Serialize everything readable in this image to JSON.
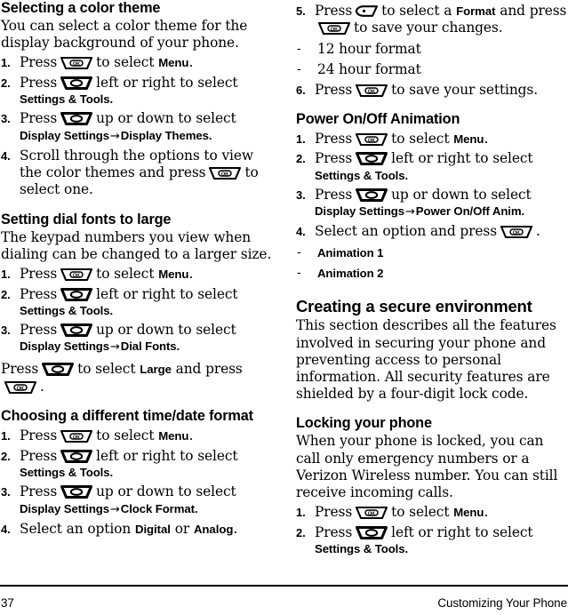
{
  "document": {
    "page_number": "37",
    "running_head": "Customizing Your Phone"
  },
  "icons": {
    "ok_key": "ok-key-icon",
    "ok_key_label": "OK",
    "direction_key": "direction-key-icon",
    "dot_key": "dot-key-icon",
    "arrow": "→",
    "dash": "-"
  },
  "left_column": {
    "sections": [
      {
        "id": "selecting-a-color-theme",
        "heading": "Selecting a color theme",
        "heading_level": "h2",
        "intro": "You can select a color theme for the display background of your phone.",
        "steps": [
          {
            "num": "1.",
            "pre": "Press",
            "key": "ok",
            "post": "to select ",
            "bold": "Menu",
            "tail": "."
          },
          {
            "num": "2.",
            "pre": "Press",
            "key": "dir",
            "post": "left or right to select",
            "path": [
              "Settings & Tools"
            ],
            "path_tail": "."
          },
          {
            "num": "3.",
            "pre": "Press",
            "key": "dir",
            "post": "up or down to select",
            "path": [
              "Display Settings",
              "Display Themes"
            ],
            "path_tail": "."
          },
          {
            "num": "4.",
            "pre": "Scroll through the options to view the color themes and press",
            "key": "ok",
            "post": "to select one."
          }
        ]
      },
      {
        "id": "setting-dial-fonts-to-large",
        "heading": "Setting dial fonts to large",
        "heading_level": "h2",
        "intro": "The keypad numbers you view when dialing can be changed to a larger size.",
        "steps": [
          {
            "num": "1.",
            "pre": "Press",
            "key": "ok",
            "post": "to select ",
            "bold": "Menu",
            "tail": "."
          },
          {
            "num": "2.",
            "pre": "Press",
            "key": "dir",
            "post": "left or right to select",
            "path": [
              "Settings & Tools"
            ],
            "path_tail": "."
          },
          {
            "num": "3.",
            "pre": "Press",
            "key": "dir",
            "post": "up or down to select",
            "path": [
              "Display Settings",
              "Dial Fonts"
            ],
            "path_tail": "."
          }
        ],
        "plain_step": {
          "pre": "Press",
          "key": "dir",
          "mid": "to select ",
          "bold": "Large",
          "mid2": " and press",
          "key2": "ok",
          "tail": "."
        }
      },
      {
        "id": "choosing-a-different-time-date-format",
        "heading": "Choosing a different time/date format",
        "heading_level": "h2",
        "steps": [
          {
            "num": "1.",
            "pre": "Press",
            "key": "ok",
            "post": "to select ",
            "bold": "Menu",
            "tail": "."
          },
          {
            "num": "2.",
            "pre": "Press",
            "key": "dir",
            "post": "left or right to select",
            "path": [
              "Settings & Tools"
            ],
            "path_tail": "."
          },
          {
            "num": "3.",
            "pre": "Press",
            "key": "dir",
            "post": "up or down to select",
            "path": [
              "Display Settings",
              "Clock Format"
            ],
            "path_tail": "."
          },
          {
            "num": "4.",
            "pre": "Select an option ",
            "bold": "Digital",
            "mid": " or ",
            "bold2": "Analog",
            "tail": "."
          }
        ]
      }
    ]
  },
  "right_column": {
    "sections": [
      {
        "id": "time-date-format-continued",
        "steps": [
          {
            "num": "5.",
            "pre": "Press",
            "key": "dot",
            "post": "to select a ",
            "bold": "Format",
            "mid": " and press",
            "key2": "ok",
            "tail": "to save your changes."
          }
        ],
        "dashes": [
          "12 hour format",
          "24 hour format"
        ],
        "dashes_bold": false,
        "steps_after": [
          {
            "num": "6.",
            "pre": "Press",
            "key": "ok",
            "post": "to save your settings."
          }
        ]
      },
      {
        "id": "power-on-off-animation",
        "heading": "Power On/Off Animation",
        "heading_level": "h2",
        "steps": [
          {
            "num": "1.",
            "pre": "Press",
            "key": "ok",
            "post": "to select ",
            "bold": "Menu",
            "tail": "."
          },
          {
            "num": "2.",
            "pre": "Press",
            "key": "dir",
            "post": "left or right to select",
            "path": [
              "Settings & Tools"
            ],
            "path_tail": "."
          },
          {
            "num": "3.",
            "pre": "Press",
            "key": "dir",
            "post": "up or down to select",
            "path": [
              "Display Settings",
              "Power On/Off Anim."
            ],
            "path_tail": ""
          },
          {
            "num": "4.",
            "pre": "Select an option and press",
            "key": "ok",
            "post": "."
          }
        ],
        "dashes": [
          "Animation 1",
          "Animation 2"
        ],
        "dashes_bold": true
      },
      {
        "id": "creating-a-secure-environment",
        "heading": "Creating a secure environment",
        "heading_level": "h1",
        "intro": "This section describes all the features involved in securing your phone and preventing access to personal information. All security features are shielded by a four-digit lock code."
      },
      {
        "id": "locking-your-phone",
        "heading": "Locking your phone",
        "heading_level": "h2",
        "intro": "When your phone is locked, you can call only emergency numbers or a Verizon Wireless number. You can still receive incoming calls.",
        "steps": [
          {
            "num": "1.",
            "pre": "Press",
            "key": "ok",
            "post": "to select ",
            "bold": "Menu",
            "tail": "."
          },
          {
            "num": "2.",
            "pre": "Press",
            "key": "dir",
            "post": "left or right to select",
            "path": [
              "Settings & Tools"
            ],
            "path_tail": "."
          }
        ]
      }
    ]
  }
}
